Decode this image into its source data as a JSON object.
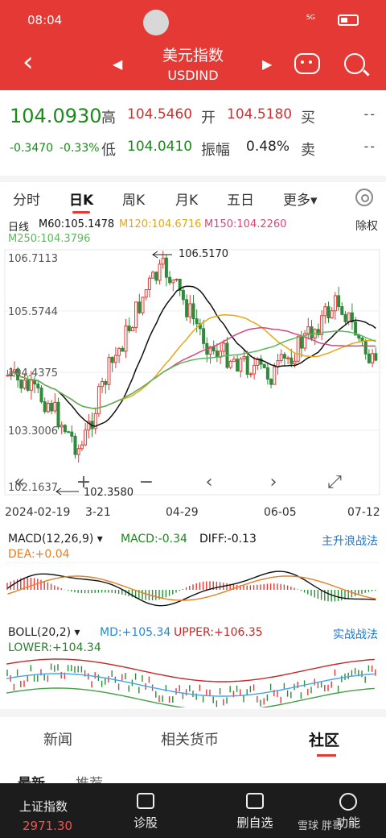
{
  "status": {
    "time": "08:04",
    "signal": "5G"
  },
  "header": {
    "title": "美元指数",
    "subtitle": "USDIND",
    "prev": "◀",
    "next": "▶"
  },
  "quote": {
    "price": "104.0930",
    "change": "-0.3470",
    "change_pct": "-0.33%",
    "high_label": "高",
    "high": "104.5460",
    "open_label": "开",
    "open": "104.5180",
    "low_label": "低",
    "low": "104.0410",
    "amp_label": "振幅",
    "amp": "0.48%",
    "buy_label": "买",
    "buy": "--",
    "sell_label": "卖",
    "sell": "--"
  },
  "tabs": [
    "分时",
    "日K",
    "周K",
    "月K",
    "五日",
    "更多▾"
  ],
  "active_tab": "日K",
  "ma": {
    "line": "日线",
    "m60": "M60:105.1478",
    "m120": "M120:104.6716",
    "m150": "M150:104.2260",
    "m250": "M250:104.3796",
    "adjust": "除权"
  },
  "colors": {
    "m60": "#111111",
    "m120": "#e6a817",
    "m150": "#d9467a",
    "m250": "#5cb85c",
    "up": "#e53935",
    "down": "#2e8b3a"
  },
  "chart_data": {
    "type": "candlestick",
    "y_ticks": [
      "106.7113",
      "105.5744",
      "104.4375",
      "103.3006",
      "102.1637"
    ],
    "x_ticks": [
      "2024-02-19",
      "3-21",
      "04-29",
      "06-05",
      "07-12"
    ],
    "annotations": {
      "high": "106.5170",
      "low": "102.3580"
    },
    "ylim": [
      102.1637,
      106.7113
    ]
  },
  "controls": [
    "«",
    "+",
    "−",
    "‹",
    "›",
    "⤢"
  ],
  "macd": {
    "label": "MACD(12,26,9)",
    "macd": "MACD:-0.34",
    "diff": "DIFF:-0.13",
    "dea": "DEA:+0.04",
    "link": "主升浪战法"
  },
  "boll": {
    "label": "BOLL(20,2)",
    "md": "MD:+105.34",
    "upper": "UPPER:+106.35",
    "lower": "LOWER:+104.34",
    "link": "实战战法"
  },
  "nav_tabs": [
    "新闻",
    "相关货币",
    "社区"
  ],
  "active_nav": "社区",
  "feed_tabs": [
    "最新",
    "推荐"
  ],
  "bottom": {
    "index_label": "上证指数",
    "index_value": "2971.30",
    "diag": "诊股",
    "del_fav": "删自选",
    "func": "功能",
    "watermark": "雪球 胖哥"
  }
}
